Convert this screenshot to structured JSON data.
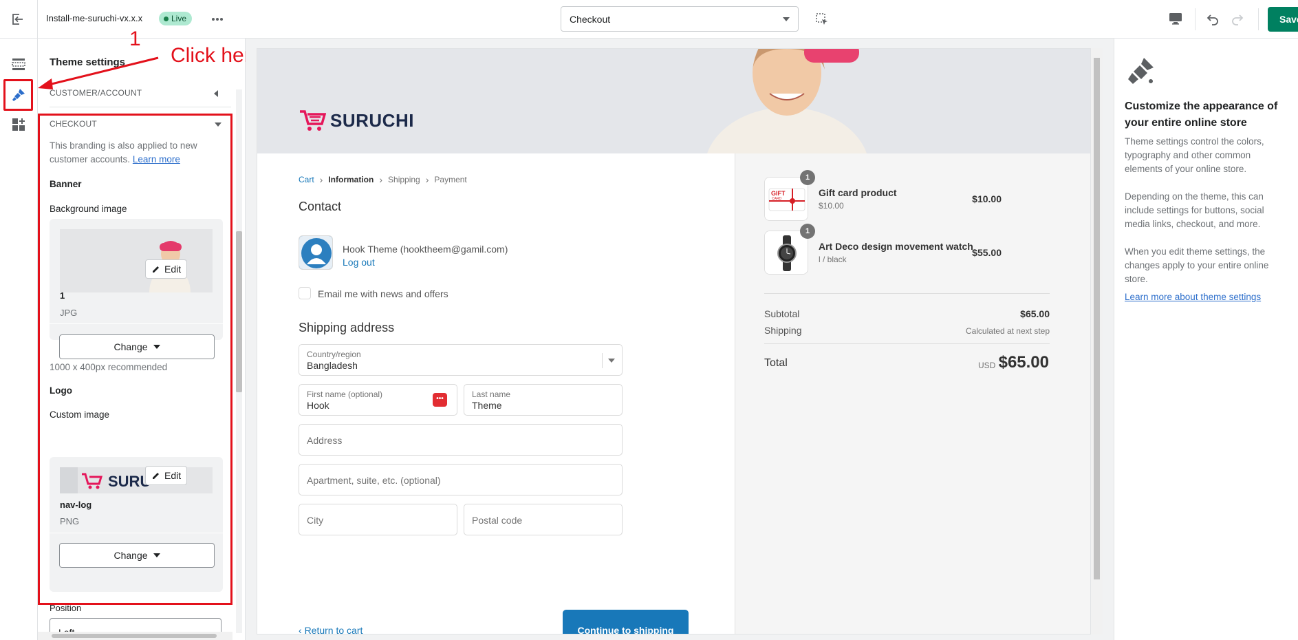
{
  "topbar": {
    "theme_name": "Install-me-suruchi-vx.x.x",
    "live_badge": "Live",
    "page_select": "Checkout",
    "save_label": "Save"
  },
  "panel": {
    "title": "Theme settings",
    "section_customer": "CUSTOMER/ACCOUNT",
    "section_checkout": "CHECKOUT",
    "checkout_desc": "This branding is also applied to new customer accounts.",
    "learn_more": "Learn more",
    "banner_label": "Banner",
    "bg_image_label": "Background image",
    "bg_file_name": "1",
    "bg_file_type": "JPG",
    "edit_label": "Edit",
    "change_label": "Change",
    "recommend": "1000 x 400px recommended",
    "logo_label": "Logo",
    "custom_image_label": "Custom image",
    "logo_file_name": "nav-log",
    "logo_file_type": "PNG",
    "position_label": "Position",
    "position_value": "Left"
  },
  "annotation": {
    "number": "1",
    "text": "Click here"
  },
  "preview": {
    "logo_text": "SURUCHI",
    "breadcrumbs": [
      "Cart",
      "Information",
      "Shipping",
      "Payment"
    ],
    "contact_heading": "Contact",
    "account_name": "Hook Theme (hooktheem@gamil.com)",
    "logout": "Log out",
    "newsletter": "Email me with news and offers",
    "shipping_heading": "Shipping address",
    "country_label": "Country/region",
    "country_value": "Bangladesh",
    "first_name_label": "First name (optional)",
    "first_name_value": "Hook",
    "last_name_label": "Last name",
    "last_name_value": "Theme",
    "address_ph": "Address",
    "apartment_ph": "Apartment, suite, etc. (optional)",
    "city_ph": "City",
    "postal_ph": "Postal code",
    "return_link": "Return to cart",
    "continue_btn": "Continue to shipping",
    "items": [
      {
        "name": "Gift card product",
        "sub": "$10.00",
        "price": "$10.00",
        "qty": "1"
      },
      {
        "name": "Art Deco design movement watch",
        "sub": "l / black",
        "price": "$55.00",
        "qty": "1"
      }
    ],
    "gift_card_text": "GIFT",
    "gift_card_sub": "CARD",
    "subtotal_label": "Subtotal",
    "subtotal_value": "$65.00",
    "shipping_label": "Shipping",
    "shipping_value": "Calculated at next step",
    "total_label": "Total",
    "total_currency": "USD",
    "total_value": "$65.00"
  },
  "info": {
    "title": "Customize the appearance of your entire online store",
    "p1": "Theme settings control the colors, typography and other common elements of your online store.",
    "p2": "Depending on the theme, this can include settings for buttons, social media links, checkout, and more.",
    "p3": "When you edit theme settings, the changes apply to your entire online store.",
    "link": "Learn more about theme settings"
  },
  "colors": {
    "accent_green": "#008060",
    "annotation_red": "#e3111b",
    "checkout_blue": "#1878b9",
    "brand_pink": "#e5175b"
  }
}
